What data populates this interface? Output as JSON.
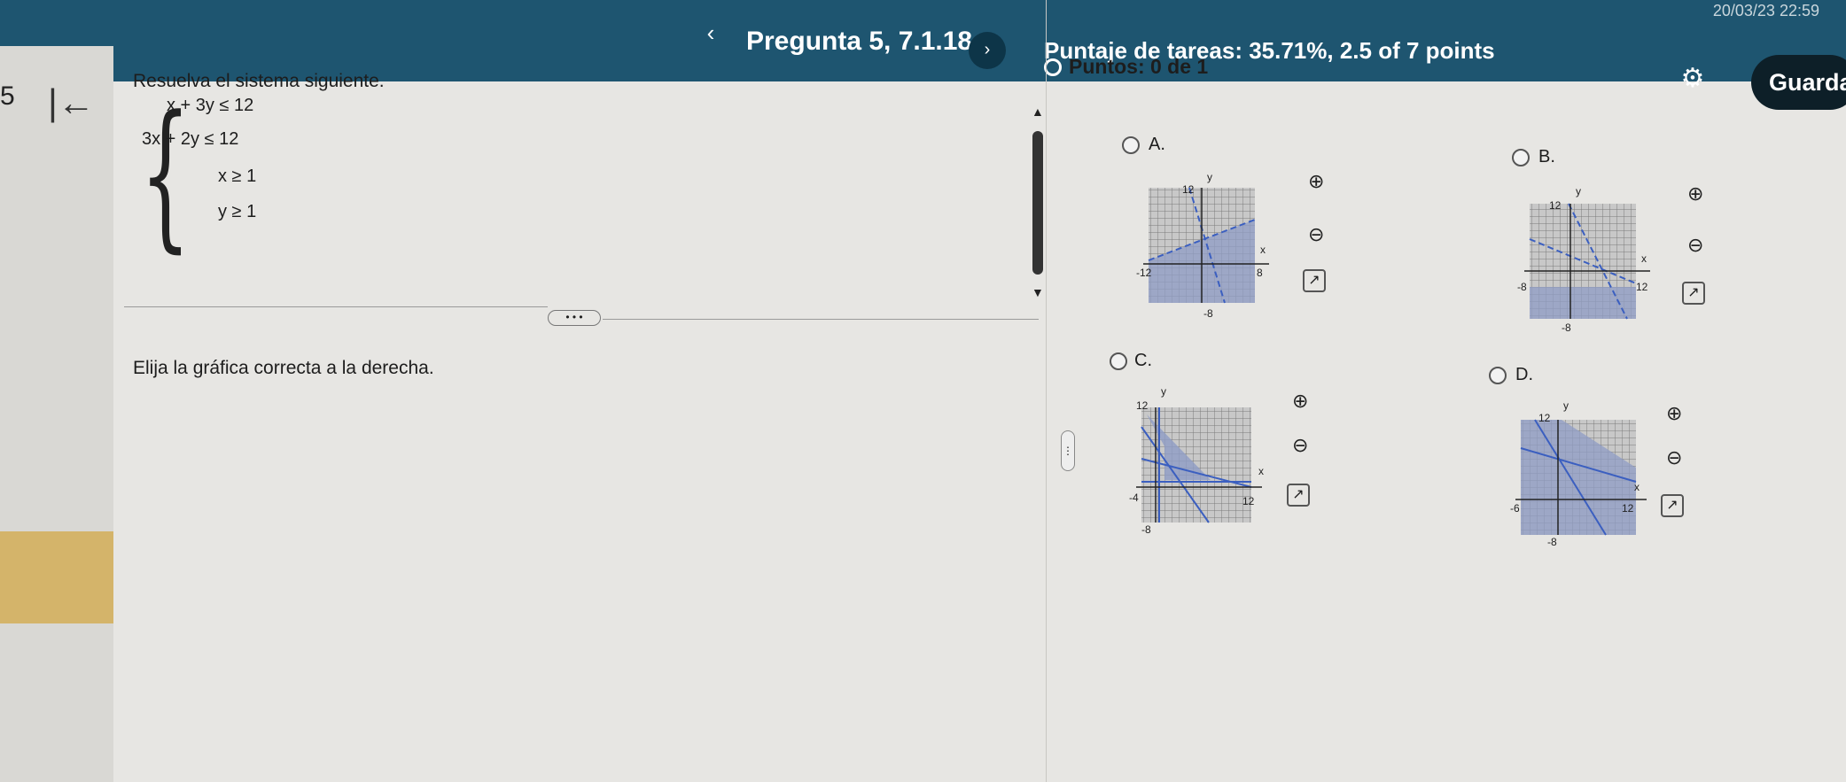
{
  "header": {
    "datetime": "20/03/23 22:59",
    "prev_icon": "chevron-left-icon",
    "prev_glyph": "‹",
    "question_title": "Pregunta 5, 7.1.18",
    "next_icon": "chevron-right-icon",
    "next_glyph": "›",
    "score_text": "Puntaje de tareas: 35.71%, 2.5 of 7 points",
    "points_text": "Puntos: 0 de 1",
    "settings_icon": "gear-icon",
    "settings_glyph": "⚙",
    "save_label": "Guarda"
  },
  "sidebar": {
    "number": "5",
    "back_icon": "first-page-icon",
    "back_glyph": "|←"
  },
  "question": {
    "instruction": "Resuelva el sistema siguiente.",
    "equations": [
      "x + 3y ≤ 12",
      "3x + 2y ≤ 12",
      "x ≥ 1",
      "y ≥ 1"
    ],
    "prompt": "Elija la gráfica correcta a la derecha.",
    "more_label": "• • •"
  },
  "options": [
    {
      "label": "A.",
      "ticks": {
        "ymax": "12",
        "xmin": "-12",
        "xmax": "8",
        "ymin": "-8"
      }
    },
    {
      "label": "B.",
      "ticks": {
        "ymax": "12",
        "xmin": "-8",
        "xmax": "12",
        "ymin": "-8"
      }
    },
    {
      "label": "C.",
      "ticks": {
        "ymax": "12",
        "xmin": "-4",
        "xmax": "12",
        "ymin": "-8"
      }
    },
    {
      "label": "D.",
      "ticks": {
        "ymax": "12",
        "xmin": "-6",
        "xmax": "12",
        "ymin": "-8"
      }
    }
  ],
  "axis_labels": {
    "x": "x",
    "y": "y"
  },
  "tools": {
    "zoom_in_icon": "zoom-in-icon",
    "zoom_out_icon": "zoom-out-icon",
    "expand_icon": "external-window-icon",
    "zoom_in_glyph": "⊕",
    "zoom_out_glyph": "⊖",
    "expand_glyph": "↗"
  },
  "colors": {
    "header": "#1e5570",
    "line": "#3b5fc0",
    "shade": "#8f9cc6"
  }
}
